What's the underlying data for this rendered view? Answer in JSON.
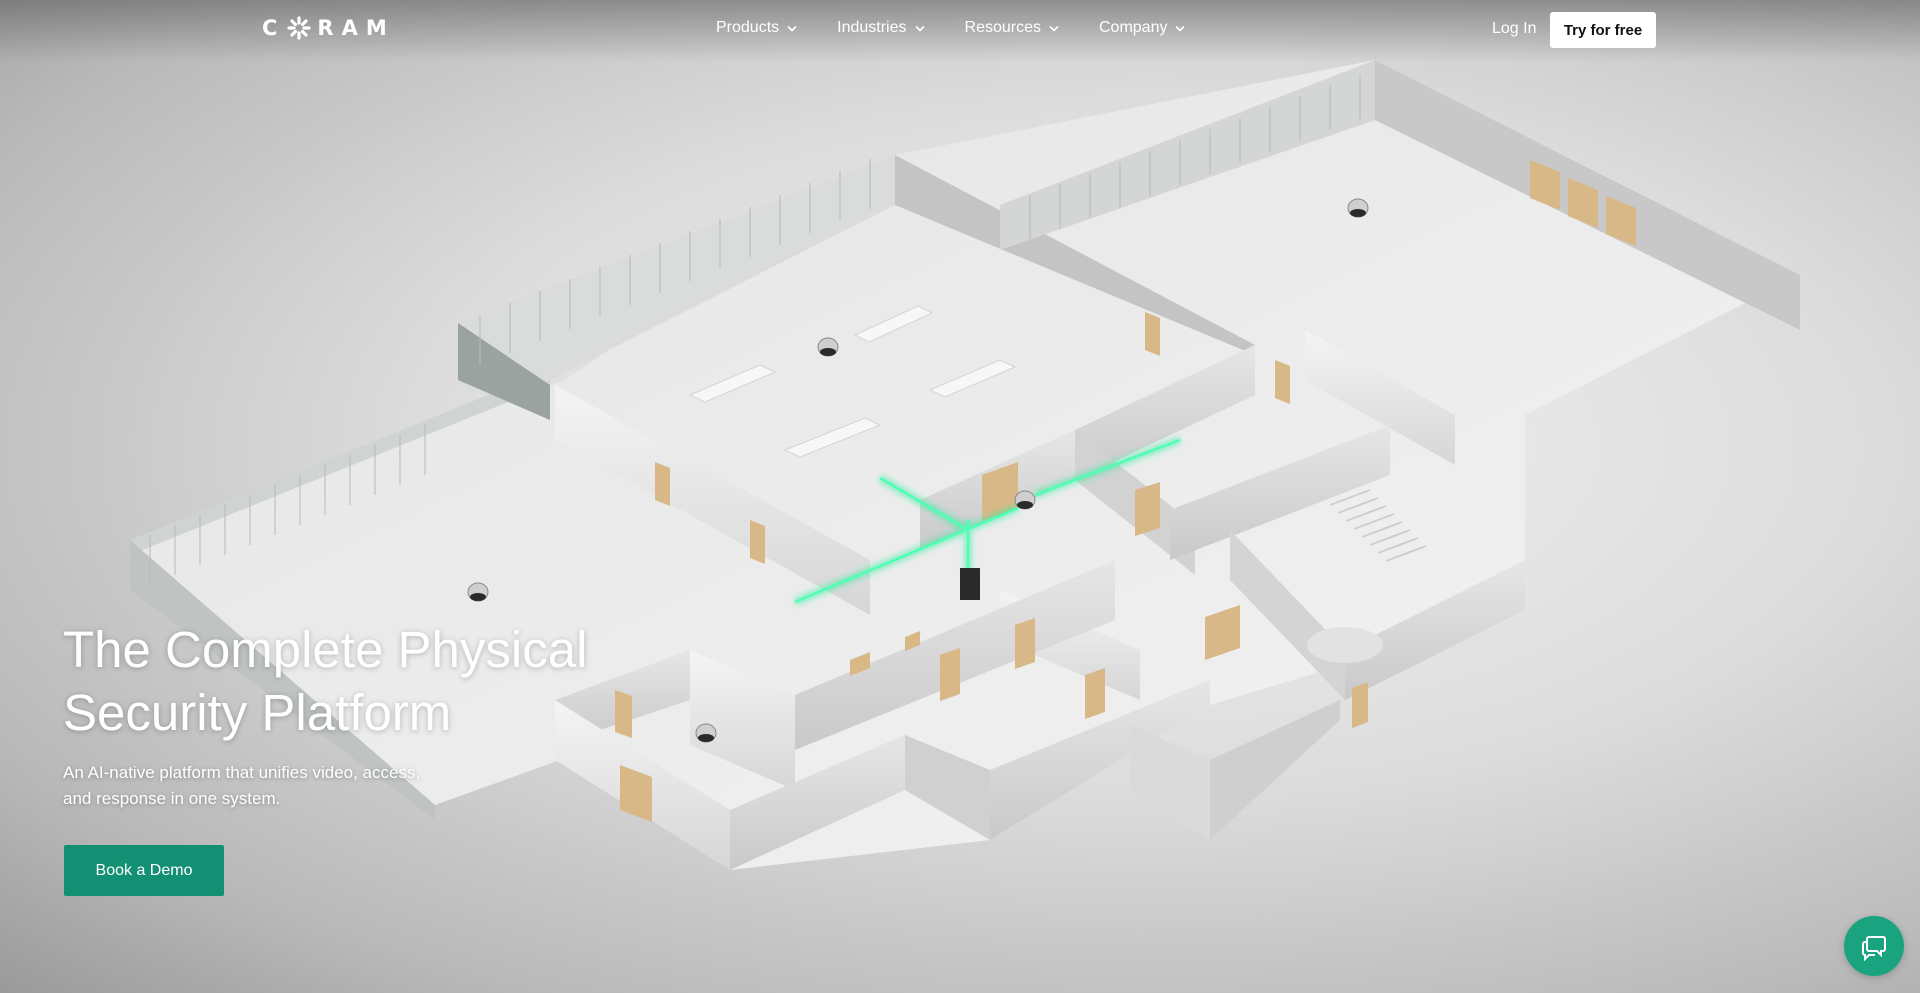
{
  "brand": {
    "logo_text_left": "C",
    "logo_text_right": "RAM"
  },
  "nav": {
    "items": [
      {
        "label": "Products"
      },
      {
        "label": "Industries"
      },
      {
        "label": "Resources"
      },
      {
        "label": "Company"
      }
    ],
    "login_label": "Log In",
    "try_label": "Try for free"
  },
  "hero": {
    "title_line1": "The Complete Physical",
    "title_line2": "Security Platform",
    "subtitle_line1": "An AI-native platform that unifies video, access,",
    "subtitle_line2": "and response in one system.",
    "cta_label": "Book a Demo"
  },
  "chat": {
    "icon": "chat-bubbles-icon"
  },
  "colors": {
    "accent": "#138f74",
    "chat": "#1aa37f",
    "laser": "#2ff0a0",
    "door": "#d8b887"
  }
}
